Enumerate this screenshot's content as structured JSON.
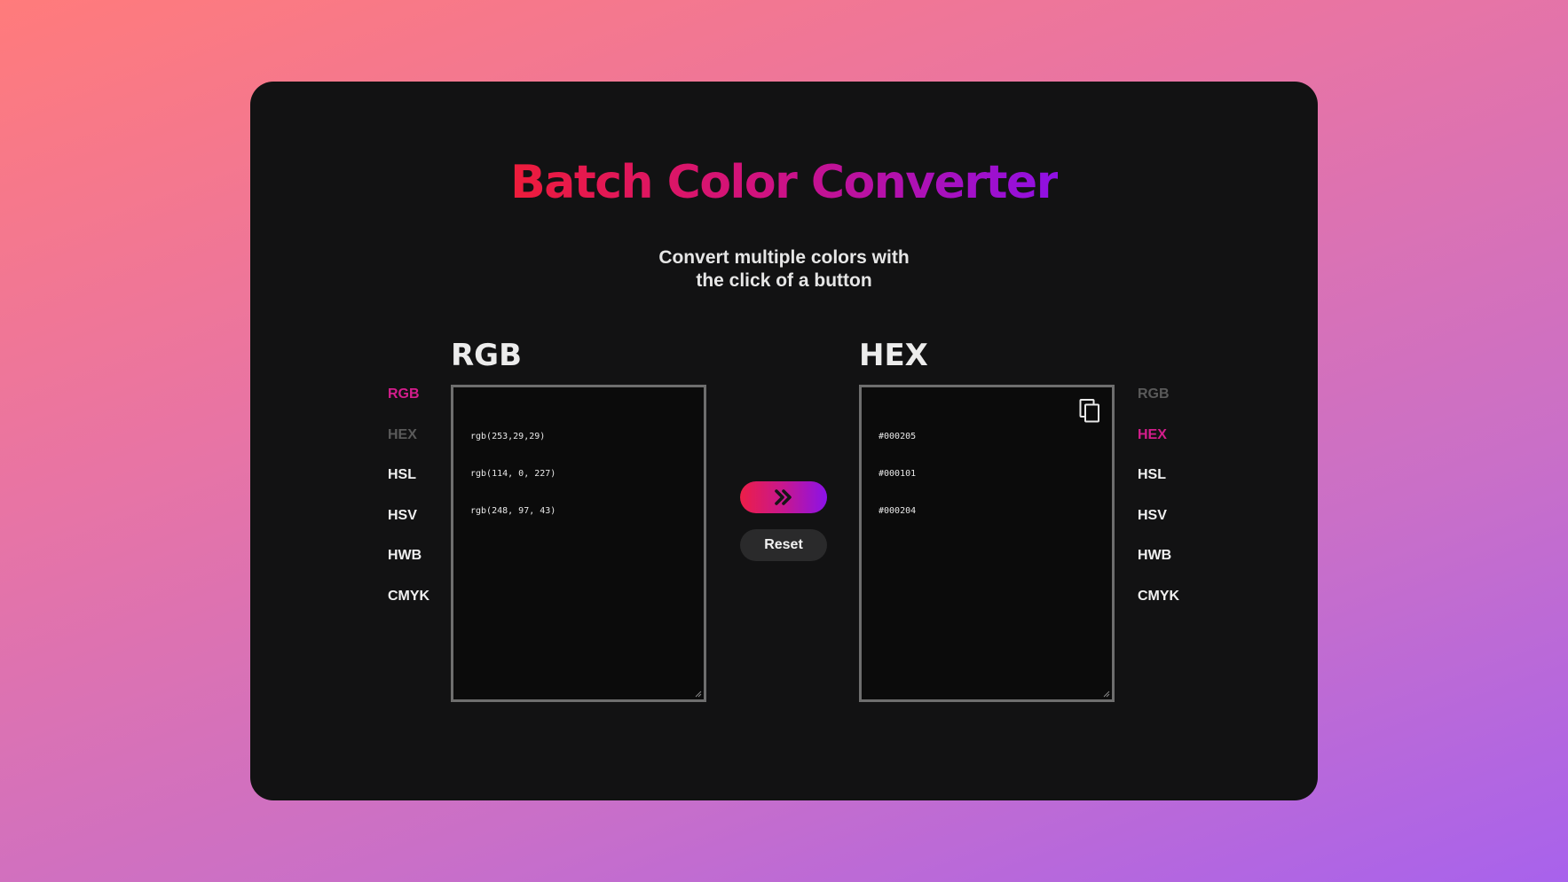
{
  "app": {
    "title": "Batch Color Converter",
    "subtitle_line1": "Convert multiple colors with",
    "subtitle_line2": "the click of a button"
  },
  "input_panel": {
    "label": "RGB",
    "lines": [
      "rgb(253,29,29)",
      "rgb(114, 0, 227)",
      "rgb(248, 97, 43)"
    ],
    "formats": [
      "RGB",
      "HEX",
      "HSL",
      "HSV",
      "HWB",
      "CMYK"
    ],
    "selected_format": "RGB",
    "disabled_format": "HEX"
  },
  "output_panel": {
    "label": "HEX",
    "lines": [
      "#000205",
      "#000101",
      "#000204"
    ],
    "formats": [
      "RGB",
      "HEX",
      "HSL",
      "HSV",
      "HWB",
      "CMYK"
    ],
    "selected_format": "HEX",
    "disabled_format": "RGB",
    "copy_icon": "copy-icon"
  },
  "controls": {
    "convert_icon": "double-chevron-right-icon",
    "reset_label": "Reset"
  },
  "colors": {
    "background_start": "#ff7b7b",
    "background_end": "#a862ec",
    "card": "#121213",
    "accent": "#d41d8c",
    "disabled": "#5a5a5a",
    "title_gradient_start": "#ee1c3a",
    "title_gradient_end": "#8f10e4"
  }
}
